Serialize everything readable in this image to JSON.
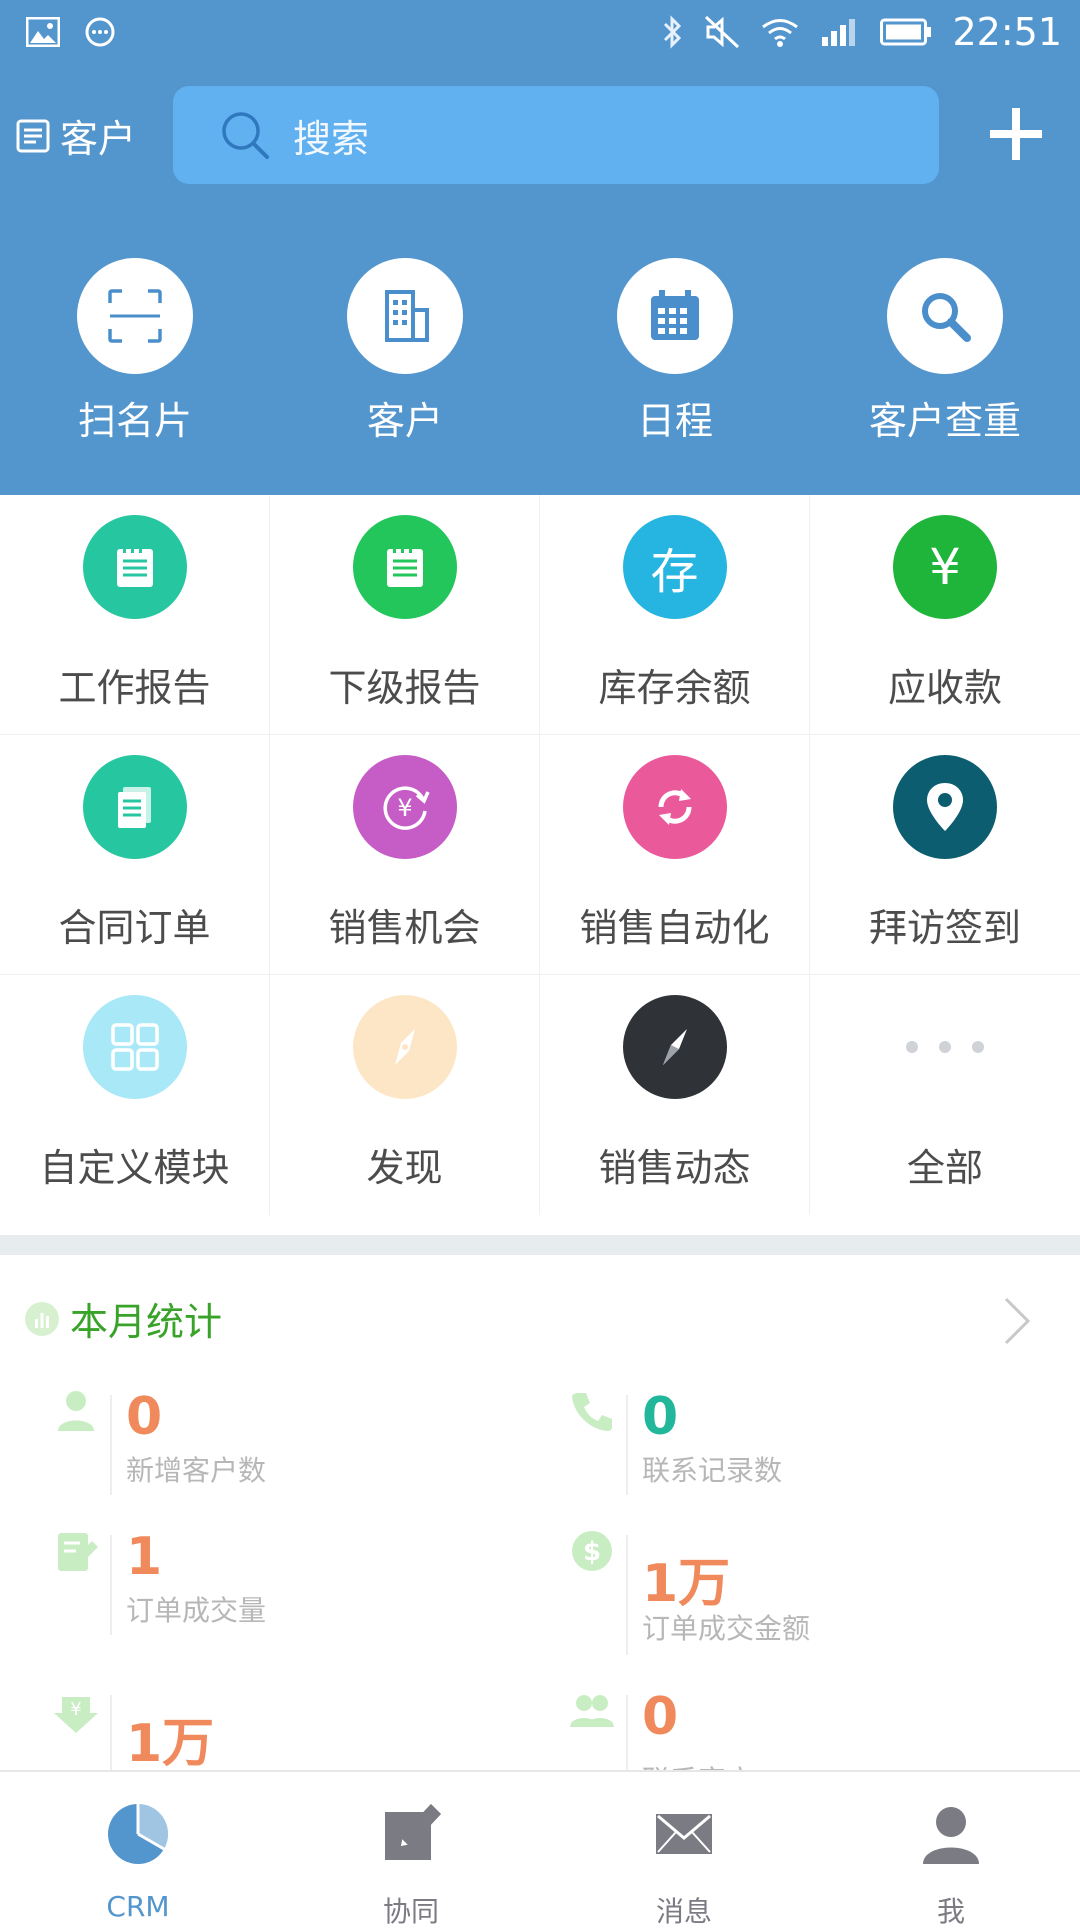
{
  "status": {
    "time": "22:51"
  },
  "header": {
    "left_label": "客户",
    "search_placeholder": "搜索"
  },
  "quick_actions": [
    {
      "label": "扫名片",
      "icon": "scan-card-icon"
    },
    {
      "label": "客户",
      "icon": "building-icon"
    },
    {
      "label": "日程",
      "icon": "calendar-icon"
    },
    {
      "label": "客户查重",
      "icon": "search-icon"
    }
  ],
  "modules": [
    {
      "label": "工作报告",
      "icon": "report-icon",
      "color": "#26c7a0"
    },
    {
      "label": "下级报告",
      "icon": "report-icon",
      "color": "#23c65a"
    },
    {
      "label": "库存余额",
      "icon": "inventory-icon",
      "color": "#26b5e0",
      "glyph": "存"
    },
    {
      "label": "应收款",
      "icon": "yen-icon",
      "color": "#1fb53a",
      "glyph": "¥"
    },
    {
      "label": "合同订单",
      "icon": "document-icon",
      "color": "#26c7a0"
    },
    {
      "label": "销售机会",
      "icon": "yen-refresh-icon",
      "color": "#c65cc6"
    },
    {
      "label": "销售自动化",
      "icon": "refresh-icon",
      "color": "#ea5a9b"
    },
    {
      "label": "拜访签到",
      "icon": "location-pin-icon",
      "color": "#0b5d6f"
    },
    {
      "label": "自定义模块",
      "icon": "grid-icon",
      "color": "#a8e8f7"
    },
    {
      "label": "发现",
      "icon": "compass-icon",
      "color": "#fde6c5"
    },
    {
      "label": "销售动态",
      "icon": "compass-dark-icon",
      "color": "#2f3338"
    },
    {
      "label": "全部",
      "icon": "more-dots-icon",
      "color": "#ffffff"
    }
  ],
  "stats": {
    "title": "本月统计",
    "items": [
      {
        "value": "0",
        "label": "新增客户数",
        "icon": "person-icon",
        "color": "#f08a5d"
      },
      {
        "value": "0",
        "label": "联系记录数",
        "icon": "phone-icon",
        "color": "#22b79a"
      },
      {
        "value": "1",
        "label": "订单成交量",
        "icon": "edit-doc-icon",
        "color": "#f08a5d"
      },
      {
        "value": "1万",
        "label": "订单成交金额",
        "icon": "dollar-icon",
        "color": "#f08a5d"
      },
      {
        "value": "1万",
        "label": "",
        "icon": "yen-down-icon",
        "color": "#f08a5d"
      },
      {
        "value": "0",
        "label": "联系客户",
        "icon": "people-icon",
        "color": "#f08a5d"
      }
    ]
  },
  "tabs": [
    {
      "label": "CRM",
      "icon": "pie-chart-icon",
      "active": true
    },
    {
      "label": "协同",
      "icon": "pencil-icon",
      "active": false
    },
    {
      "label": "消息",
      "icon": "mail-icon",
      "active": false
    },
    {
      "label": "我",
      "icon": "profile-icon",
      "active": false
    }
  ],
  "colors": {
    "header_bg": "#5395cd",
    "search_bg": "#61b0f0",
    "tab_active": "#5395cd",
    "tab_inactive": "#7b7b84",
    "stats_title": "#39a329"
  }
}
